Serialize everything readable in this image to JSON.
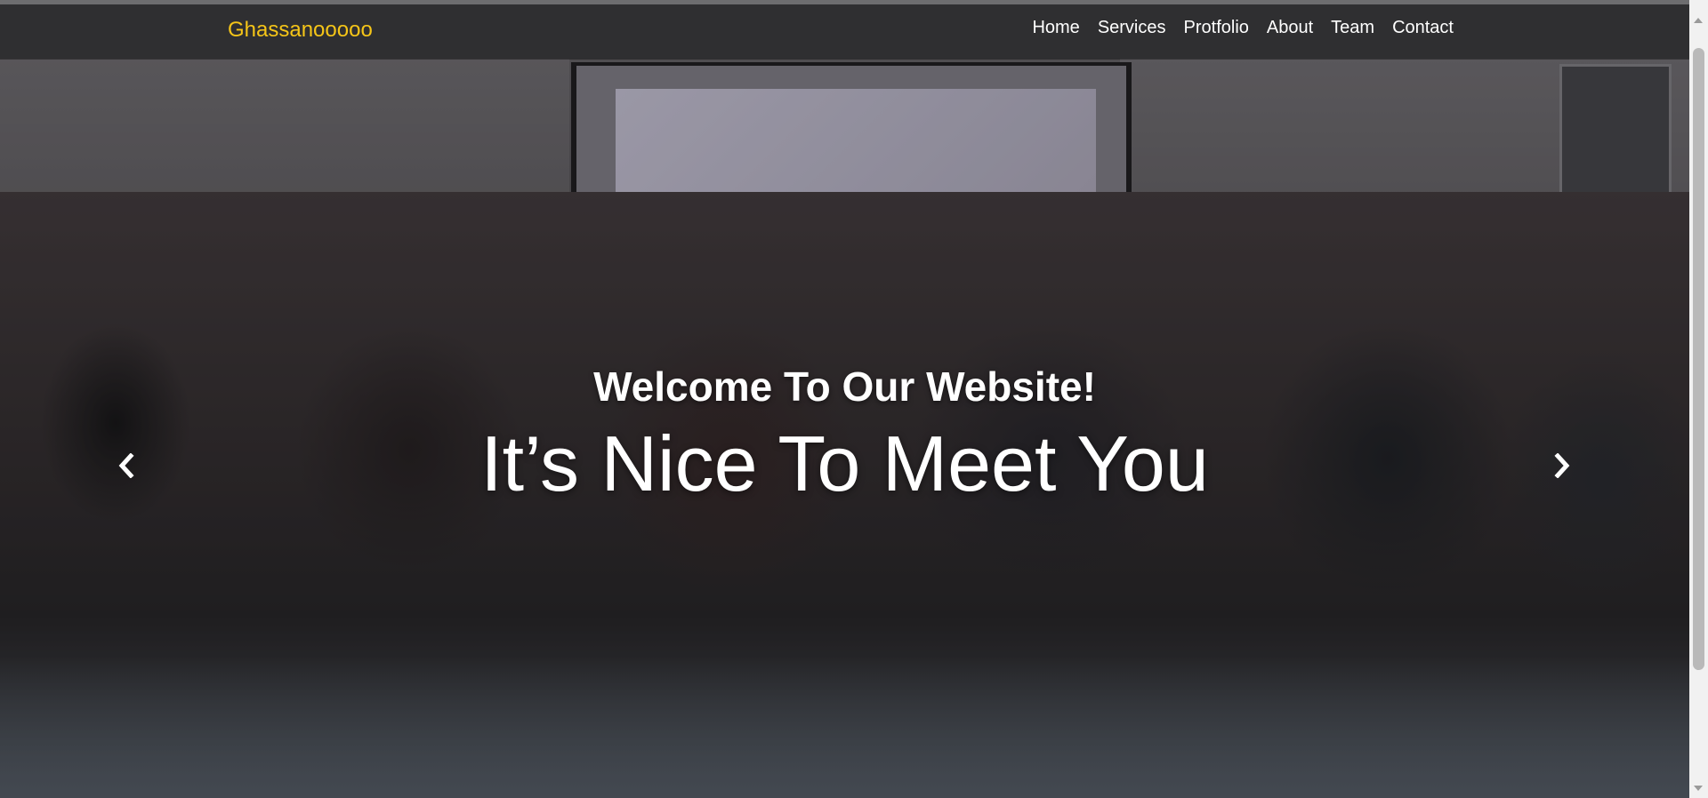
{
  "navbar": {
    "brand": "Ghassanooooo",
    "links": [
      "Home",
      "Services",
      "Protfolio",
      "About",
      "Team",
      "Contact"
    ],
    "brand_color": "#f5c518",
    "background_color": "#2f2f31"
  },
  "hero": {
    "welcome": "Welcome To Our Website!",
    "headline": "It’s Nice To Meet You",
    "prev_icon": "chevron-left-icon",
    "next_icon": "chevron-right-icon"
  }
}
